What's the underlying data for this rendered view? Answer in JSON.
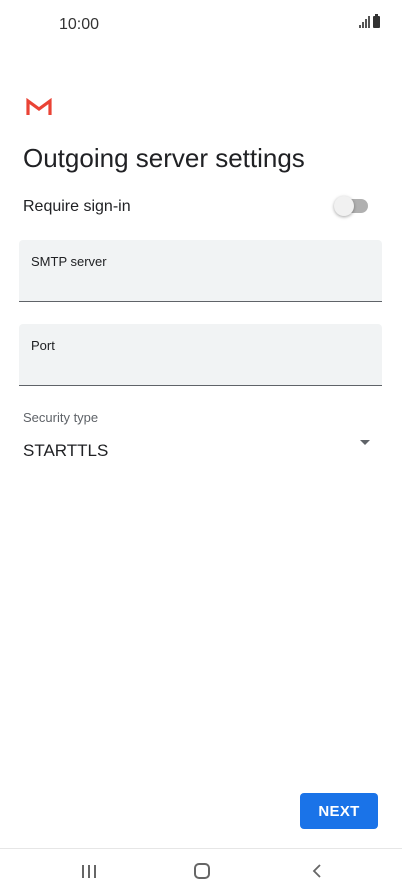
{
  "status_bar": {
    "time": "10:00",
    "icons": [
      "signal-icon",
      "battery-icon"
    ]
  },
  "app": {
    "logo": "gmail-logo",
    "brand_color": "#EA4335"
  },
  "page": {
    "title": "Outgoing server settings"
  },
  "require_signin": {
    "label": "Require sign-in",
    "enabled": false
  },
  "smtp_server": {
    "label": "SMTP server",
    "value": ""
  },
  "port": {
    "label": "Port",
    "value": ""
  },
  "security_type": {
    "label": "Security type",
    "value": "STARTTLS"
  },
  "actions": {
    "next_label": "NEXT",
    "accent_color": "#1A73E8"
  },
  "nav_bar": {
    "icons": [
      "recents-icon",
      "home-icon",
      "back-icon"
    ]
  }
}
